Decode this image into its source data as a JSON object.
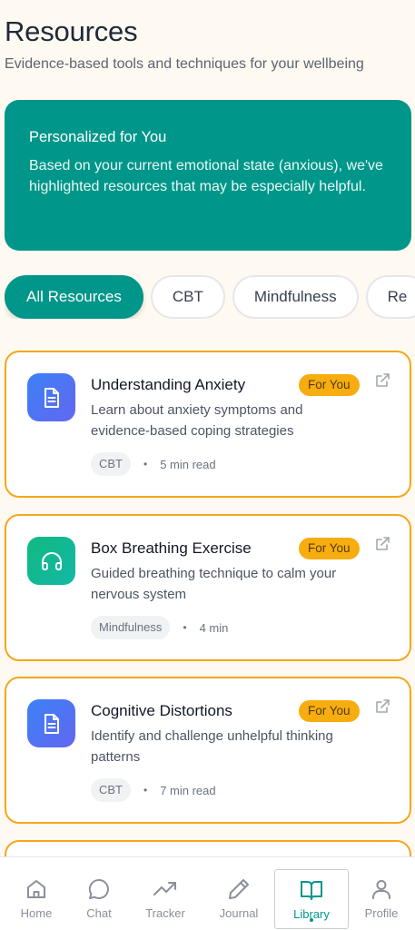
{
  "header": {
    "title": "Resources",
    "subtitle": "Evidence-based tools and techniques for your wellbeing"
  },
  "personalized": {
    "title": "Personalized for You",
    "text": "Based on your current emotional state (anxious), we've highlighted resources that may be especially helpful."
  },
  "filters": [
    {
      "label": "All Resources",
      "active": true
    },
    {
      "label": "CBT",
      "active": false
    },
    {
      "label": "Mindfulness",
      "active": false
    },
    {
      "label": "Re",
      "active": false
    }
  ],
  "resources": [
    {
      "title": "Understanding Anxiety",
      "badge": "For You",
      "description": "Learn about anxiety symptoms and evidence-based coping strategies",
      "tag": "CBT",
      "time": "5 min read",
      "icon": "document-icon"
    },
    {
      "title": "Box Breathing Exercise",
      "badge": "For You",
      "description": "Guided breathing technique to calm your nervous system",
      "tag": "Mindfulness",
      "time": "4 min",
      "icon": "headphones-icon"
    },
    {
      "title": "Cognitive Distortions",
      "badge": "For You",
      "description": "Identify and challenge unhelpful thinking patterns",
      "tag": "CBT",
      "time": "7 min read",
      "icon": "document-icon"
    }
  ],
  "nav": [
    {
      "label": "Home",
      "icon": "home-icon"
    },
    {
      "label": "Chat",
      "icon": "chat-icon"
    },
    {
      "label": "Tracker",
      "icon": "trending-up-icon"
    },
    {
      "label": "Journal",
      "icon": "pen-icon"
    },
    {
      "label": "Library",
      "icon": "book-icon",
      "active": true
    },
    {
      "label": "Profile",
      "icon": "user-icon"
    }
  ],
  "colors": {
    "accent": "#00968a",
    "highlight_border": "#f6a61c",
    "badge": "#f7ad0f",
    "background": "#fffaf1"
  }
}
